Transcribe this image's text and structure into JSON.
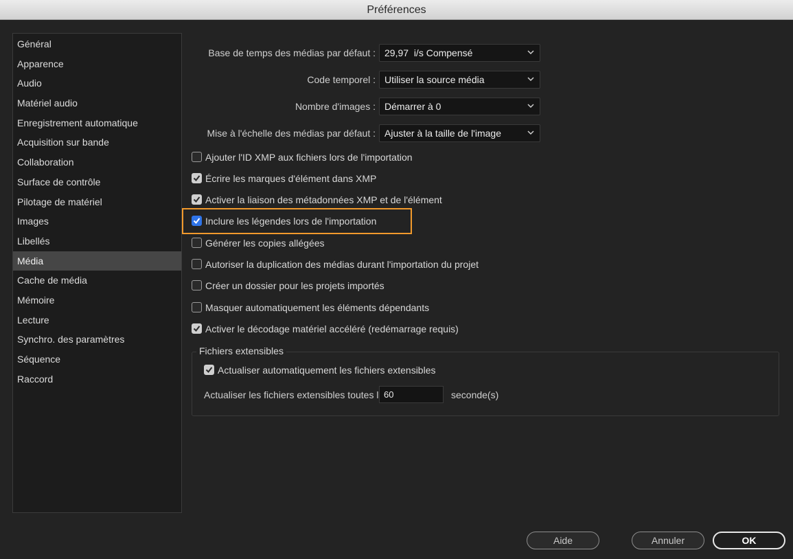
{
  "window": {
    "title": "Préférences"
  },
  "sidebar": {
    "items": [
      {
        "label": "Général"
      },
      {
        "label": "Apparence"
      },
      {
        "label": "Audio"
      },
      {
        "label": "Matériel audio"
      },
      {
        "label": "Enregistrement automatique"
      },
      {
        "label": "Acquisition sur bande"
      },
      {
        "label": "Collaboration"
      },
      {
        "label": "Surface de contrôle"
      },
      {
        "label": "Pilotage de matériel"
      },
      {
        "label": "Images"
      },
      {
        "label": "Libellés"
      },
      {
        "label": "Média"
      },
      {
        "label": "Cache de média"
      },
      {
        "label": "Mémoire"
      },
      {
        "label": "Lecture"
      },
      {
        "label": "Synchro. des paramètres"
      },
      {
        "label": "Séquence"
      },
      {
        "label": "Raccord"
      }
    ],
    "selected": "Média"
  },
  "form": {
    "timebase": {
      "label": "Base de temps des médias par défaut :",
      "value": "29,97  i/s Compensé"
    },
    "timecode": {
      "label": "Code temporel :",
      "value": "Utiliser la source média"
    },
    "frame_count": {
      "label": "Nombre d'images :",
      "value": "Démarrer à 0"
    },
    "scaling": {
      "label": "Mise à l'échelle des médias par défaut :",
      "value": "Ajuster à la taille de l'image"
    }
  },
  "checkboxes": [
    {
      "label": "Ajouter l'ID XMP aux fichiers lors de l'importation",
      "checked": false
    },
    {
      "label": "Écrire les marques d'élément dans XMP",
      "checked": true
    },
    {
      "label": "Activer la liaison des métadonnées XMP et de l'élément",
      "checked": true
    },
    {
      "label": "Inclure les légendes lors de l'importation",
      "checked": true
    },
    {
      "label": "Générer les copies allégées",
      "checked": false
    },
    {
      "label": "Autoriser la duplication des médias durant l'importation du projet",
      "checked": false
    },
    {
      "label": "Créer un dossier pour les projets importés",
      "checked": false
    },
    {
      "label": "Masquer automatiquement les éléments dépendants",
      "checked": false
    },
    {
      "label": "Activer le décodage matériel accéléré (redémarrage requis)",
      "checked": true
    }
  ],
  "growing_files": {
    "title": "Fichiers extensibles",
    "auto_refresh": {
      "label": "Actualiser automatiquement les fichiers extensibles",
      "checked": true
    },
    "interval_label": "Actualiser les fichiers extensibles toutes les",
    "interval_value": "60",
    "interval_unit": "seconde(s)"
  },
  "buttons": {
    "help": "Aide",
    "cancel": "Annuler",
    "ok": "OK"
  },
  "colors": {
    "highlight": "#f29a2c",
    "checkbox_active": "#2f74e8",
    "sidebar_selected": "#464646"
  }
}
